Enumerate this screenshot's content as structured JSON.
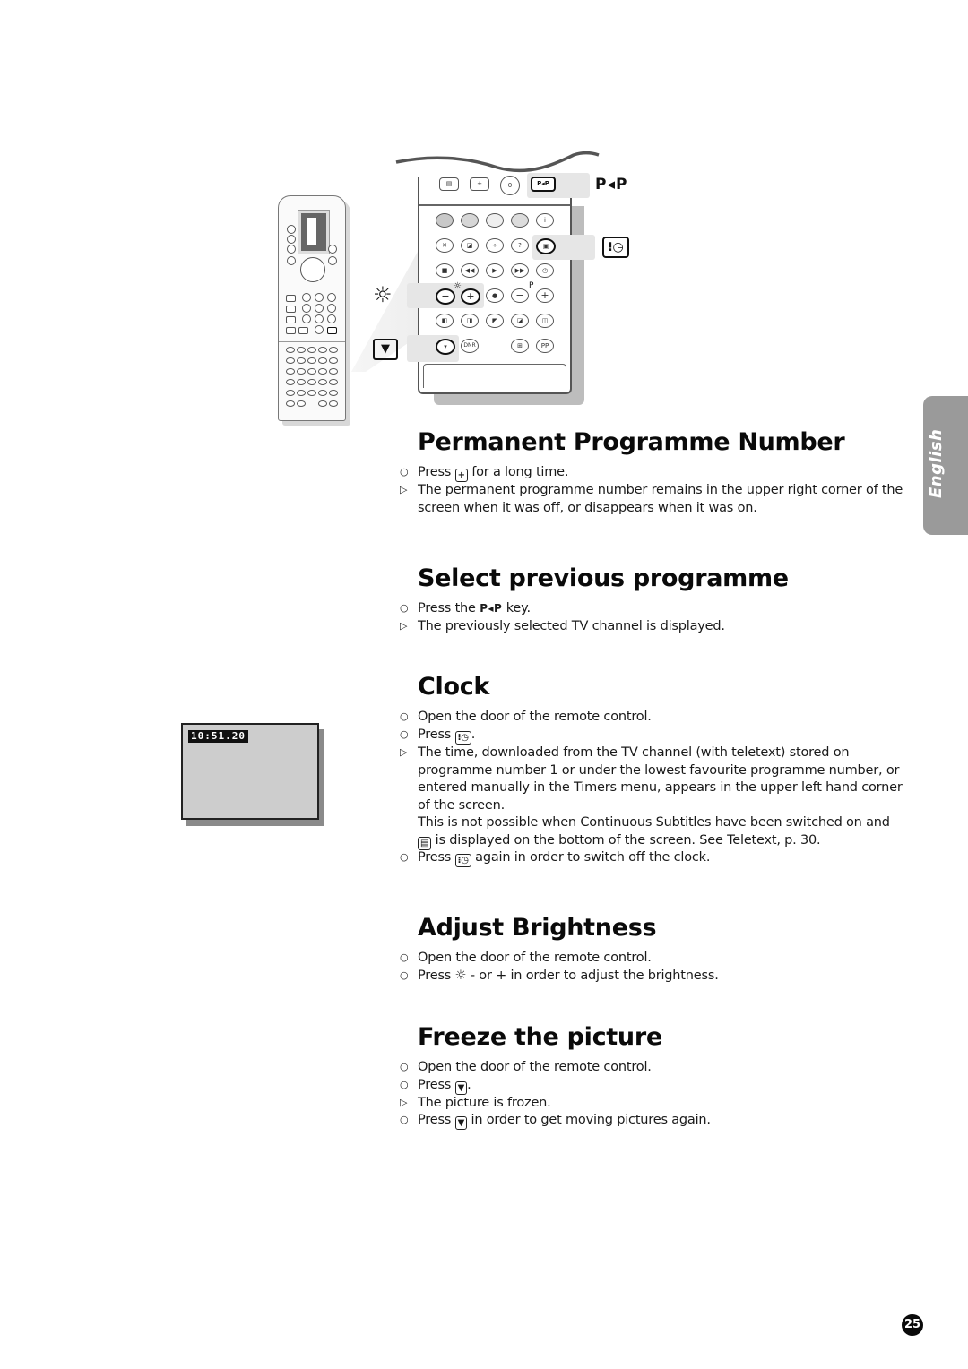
{
  "illustration": {
    "pip_key_label": "P◂P",
    "pip_key_small": "P◂P",
    "clock_icon": "clock-teletext-icon",
    "brightness_icon": "sun-icon",
    "freeze_icon": "freeze-icon",
    "plus_minus_p_label": "P",
    "dnr_label": "DNR",
    "pp_label": "PP"
  },
  "sections": [
    {
      "title": "Permanent Programme Number",
      "items": [
        {
          "type": "step",
          "before": "Press",
          "key": "+",
          "after": "for a long time."
        },
        {
          "type": "result",
          "lines": [
            "The permanent programme number remains in the upper right corner of the",
            "screen when it was off, or disappears when it was on."
          ]
        }
      ]
    },
    {
      "title": "Select previous programme",
      "items": [
        {
          "type": "step",
          "before": "Press the",
          "key": "P◂P",
          "after": "key."
        },
        {
          "type": "result",
          "lines": [
            "The previously selected TV channel is displayed."
          ]
        }
      ]
    },
    {
      "title": "Clock",
      "items": [
        {
          "type": "step",
          "text": "Open the door of the remote control."
        },
        {
          "type": "step",
          "before": "Press",
          "key": "clock",
          "after": "."
        },
        {
          "type": "result",
          "lines": [
            "The time, downloaded from the TV channel (with teletext) stored on",
            "programme number 1 or under the lowest favourite programme number, or",
            "entered manually in the Timers menu, appears in the upper left hand corner",
            "of the screen.",
            "This is not possible when Continuous Subtitles have been switched on and"
          ]
        },
        {
          "type": "note",
          "key": "teletext",
          "after": "is displayed on the bottom of the screen. See Teletext, p. 30."
        },
        {
          "type": "step",
          "before": "Press",
          "key": "clock",
          "after": "again in order to switch off the clock."
        }
      ]
    },
    {
      "title": "Adjust Brightness",
      "items": [
        {
          "type": "step",
          "text": "Open the door of the remote control."
        },
        {
          "type": "step",
          "before": "Press",
          "key": "sun",
          "after": "- or + in order to adjust the brightness."
        }
      ]
    },
    {
      "title": "Freeze the picture",
      "items": [
        {
          "type": "step",
          "text": "Open the door of the remote control."
        },
        {
          "type": "step",
          "before": "Press",
          "key": "freeze",
          "after": "."
        },
        {
          "type": "result",
          "lines": [
            "The picture is frozen."
          ]
        },
        {
          "type": "step",
          "before": "Press",
          "key": "freeze",
          "after": "in order to get moving pictures again."
        }
      ]
    }
  ],
  "tv_screen": {
    "time": "10:51.20"
  },
  "language_tab": "English",
  "page_number": "25"
}
